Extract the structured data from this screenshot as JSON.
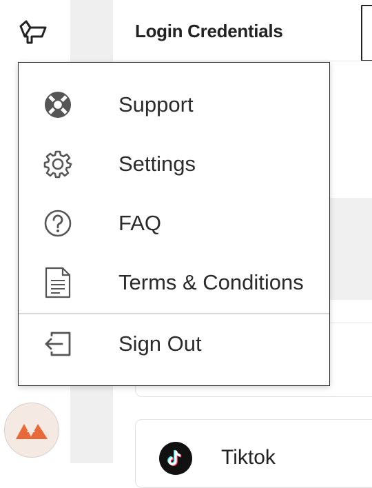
{
  "header": {
    "title": "Login Credentials"
  },
  "menu": {
    "items": [
      {
        "label": "Support",
        "icon": "lifebuoy-icon"
      },
      {
        "label": "Settings",
        "icon": "gear-icon"
      },
      {
        "label": "FAQ",
        "icon": "question-circle-icon"
      },
      {
        "label": "Terms & Conditions",
        "icon": "document-icon"
      }
    ],
    "sign_out": {
      "label": "Sign Out",
      "icon": "sign-out-icon"
    }
  },
  "cards": [
    {
      "label": "Tiktok",
      "icon": "tiktok-icon"
    }
  ],
  "colors": {
    "brand_accent": "#e8693a",
    "avatar_bg": "#f4e9e3",
    "gutter": "#efefef"
  }
}
